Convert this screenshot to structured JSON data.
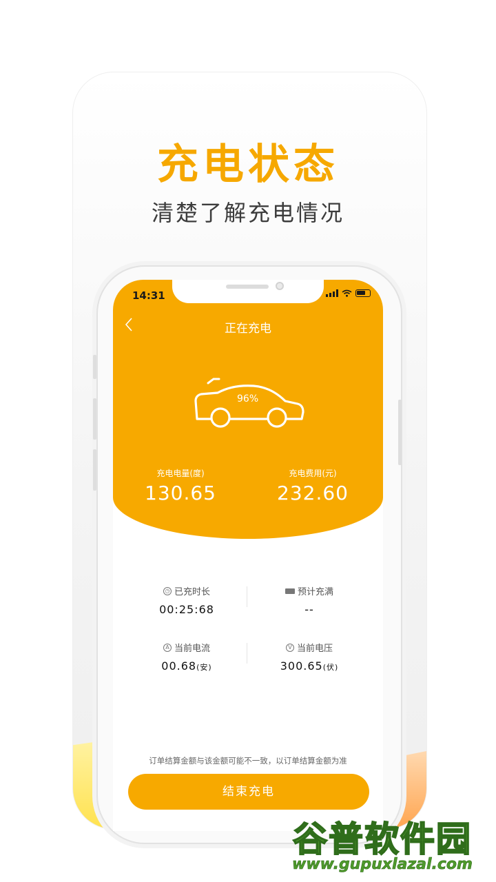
{
  "promo": {
    "headline": "充电状态",
    "subline": "清楚了解充电情况"
  },
  "status_bar": {
    "time": "14:31",
    "icons": [
      "signal-icon",
      "wifi-icon",
      "battery-icon"
    ]
  },
  "nav": {
    "back_icon": "chevron-left-icon",
    "title": "正在充电"
  },
  "car": {
    "percent": "96%"
  },
  "stats": {
    "energy_label": "充电电量(度)",
    "energy_value": "130.65",
    "cost_label": "充电费用(元)",
    "cost_value": "232.60"
  },
  "info": {
    "duration_label": "已充时长",
    "duration_value": "00:25:68",
    "eta_label": "预计充满",
    "eta_value": "--",
    "current_label": "当前电流",
    "current_value": "00.68",
    "current_unit": "(安)",
    "voltage_label": "当前电压",
    "voltage_value": "300.65",
    "voltage_unit": "(伏)"
  },
  "footer": {
    "notice": "订单结算金额与该金额可能不一致，以订单结算金额为准",
    "end_button": "结束充电"
  },
  "watermark": {
    "logo": "谷普软件园",
    "url": "www.gupuxlazal.com"
  },
  "colors": {
    "accent": "#f7a900",
    "headline": "#f6a800",
    "watermark_green": "#6cbf3a"
  }
}
